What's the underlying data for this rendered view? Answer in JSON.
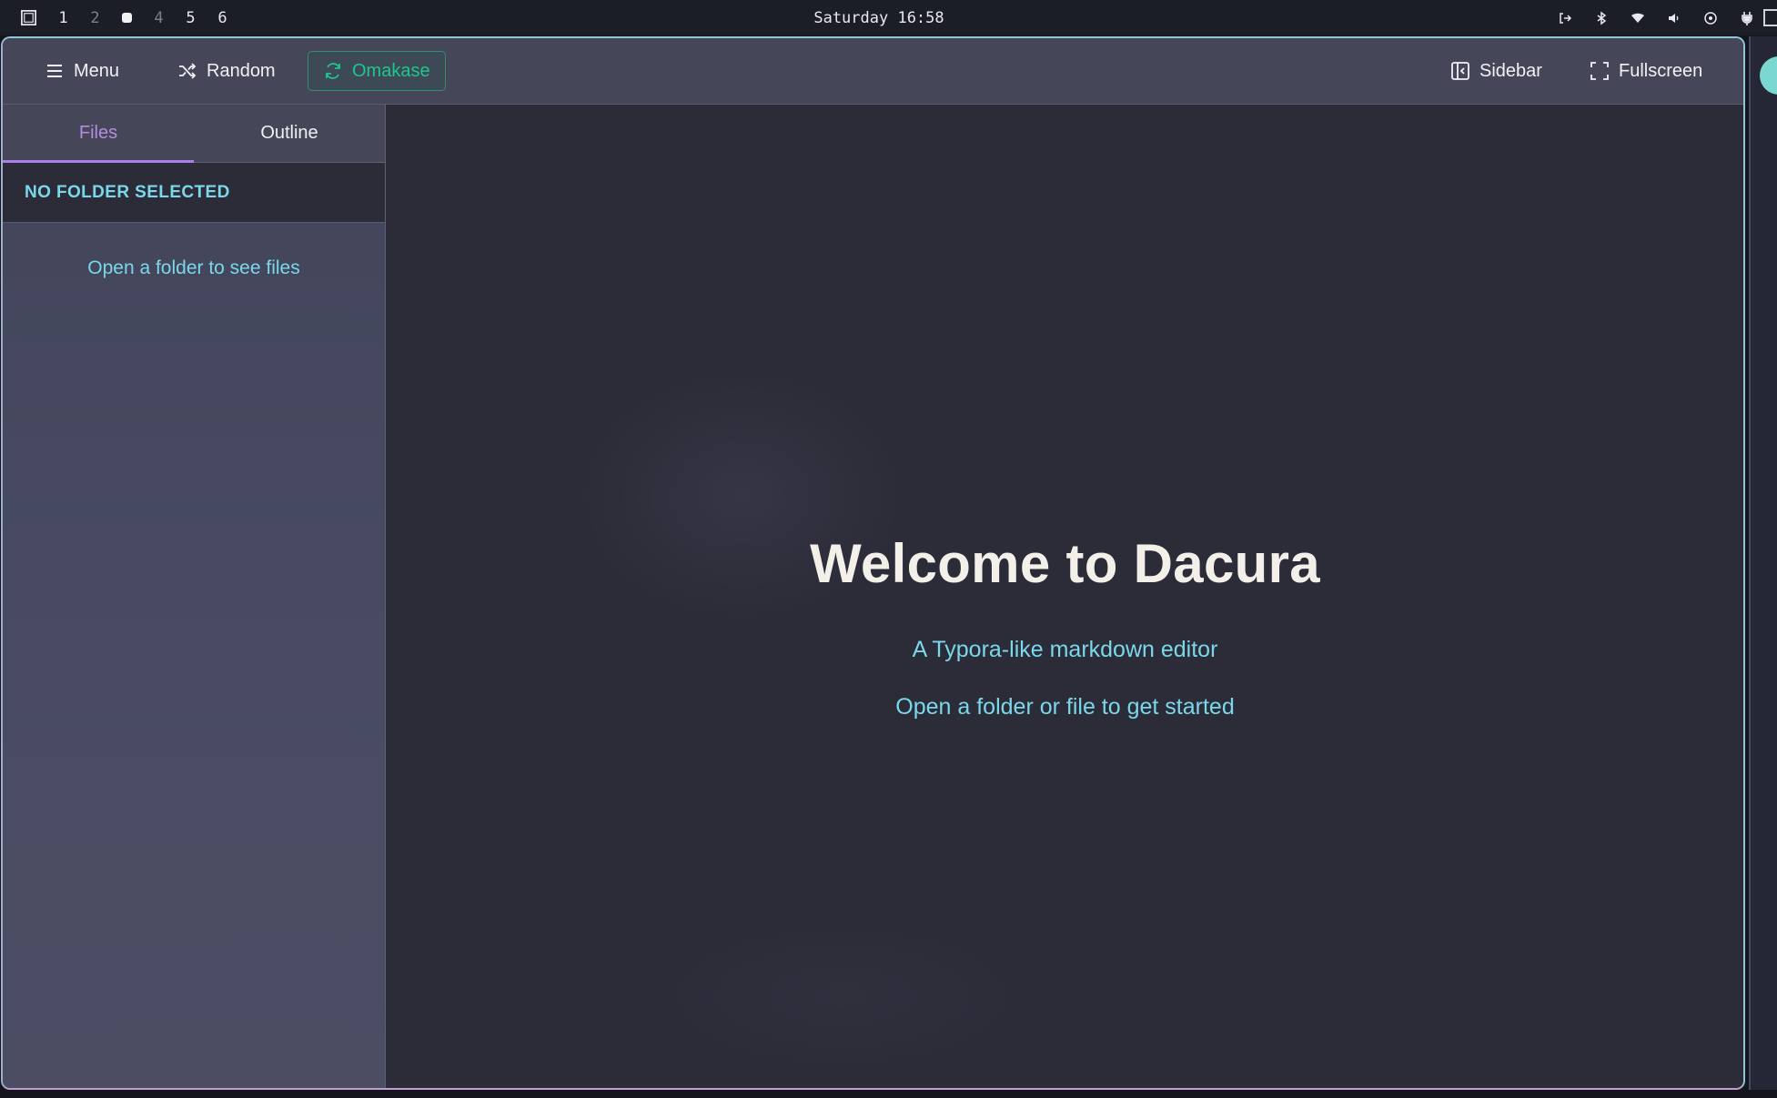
{
  "system_bar": {
    "workspaces": [
      {
        "label": "1",
        "dim": false
      },
      {
        "label": "2",
        "dim": true
      },
      {
        "label": "",
        "current": true
      },
      {
        "label": "4",
        "dim": true
      },
      {
        "label": "5",
        "dim": false
      },
      {
        "label": "6",
        "dim": false
      }
    ],
    "clock": "Saturday 16:58",
    "tray_icons": [
      "logout-icon",
      "bluetooth-icon",
      "wifi-icon",
      "volume-icon",
      "system-monitor-icon",
      "power-plug-icon"
    ]
  },
  "toolbar": {
    "menu_label": "Menu",
    "random_label": "Random",
    "omakase_label": "Omakase",
    "sidebar_label": "Sidebar",
    "fullscreen_label": "Fullscreen"
  },
  "sidebar": {
    "tabs": [
      {
        "label": "Files",
        "active": true
      },
      {
        "label": "Outline",
        "active": false
      }
    ],
    "folder_status": "NO FOLDER SELECTED",
    "empty_hint": "Open a folder to see files"
  },
  "main": {
    "title": "Welcome to Dacura",
    "subtitle": "A Typora-like markdown editor",
    "hint": "Open a folder or file to get started"
  },
  "colors": {
    "accent_cyan": "#7ad8ea",
    "accent_purple": "#a97ee6",
    "accent_green": "#1fc58d",
    "window_border": "#8fc5d6"
  }
}
